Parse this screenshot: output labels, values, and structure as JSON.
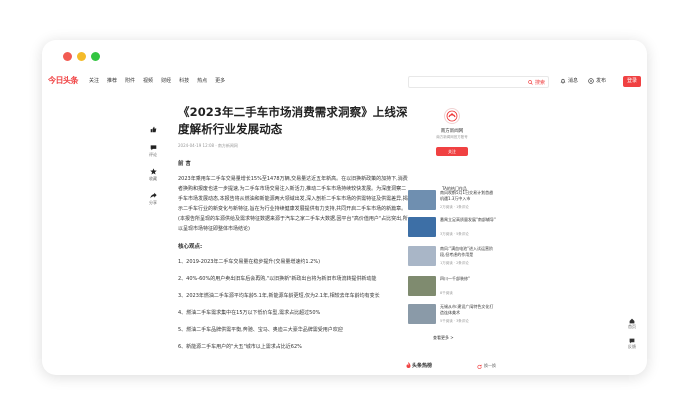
{
  "nav": {
    "logo": "今日头条",
    "links": [
      "关注",
      "推荐",
      "附件",
      "视频",
      "财经",
      "科技",
      "热点",
      "更多"
    ],
    "search_placeholder": "",
    "search_label": "搜索",
    "right": [
      "消息",
      "发布"
    ],
    "login": "登录"
  },
  "actions": [
    {
      "icon": "thumb-up-icon",
      "label": ""
    },
    {
      "icon": "comment-icon",
      "label": "评论"
    },
    {
      "icon": "star-icon",
      "label": "收藏"
    },
    {
      "icon": "share-icon",
      "label": "分享"
    }
  ],
  "article": {
    "title": "《2023年二手车市场消费需求洞察》上线深度解析行业发展动态",
    "meta": "2024-04-19 12:08 · 南方新闻网",
    "pre_heading": "前 言",
    "intro": "2023年乘用车二手车交易量增长15%至1478万辆,交易量达近五年新高。在以旧换新政策的加持下,消费者换购和报废也进一步提速,为二手车市场交易注入新活力,推动二手车市场持续较快发展。为深度洞察二手车市场发展动态,本报告将从燃油和新能源两大领域出发,深入剖析二手车市场的供需特征及供需差异,揭示二手车行业的新变化与新特征,旨在为行业持续健康发展提供有力支持,共同开启二手车市场的新篇章。(本报告所呈现的车源供给及需求特征数据来源于汽车之家二手车大数据,因平台\"高价值用户\"占比突出,所以呈现市场特征即整体市场结论)",
    "core_heading": "核心观点:",
    "points": [
      "1、2019-2023年二手车交易量在稳步提升(交易量增速约1.2%)",
      "2、40%-60%的用户卖出旧车后会再购,\"以旧换新\"新政出台将为新旧市场流转提供新动能",
      "3、2023年燃油二手车源平均车龄5.1年,新能源车龄更短,仅为2.1年,相较去年车龄均有变长",
      "4、燃油二手车需求集中在15万以下低价车型,需求占比超过50%",
      "5、燃油二手车品牌供需平衡,奔驰、宝马、奥迪三大豪华品牌需受用户欢迎",
      "6、新能源二手车用户的\"大五\"城市以上需求占比近62%"
    ]
  },
  "author": {
    "name": "南方新闻网",
    "desc": "南方新闻网官方账号",
    "follow": "关注"
  },
  "works_heading": "TA的热门作品",
  "works": [
    {
      "title": "南风吹鹤5月1日交易计划首趟机遇1.3万中入市",
      "stat": "2万阅读 · 1条评论",
      "color": "#6f8fb0"
    },
    {
      "title": "番禺立足高质量发展\"南部辅导\"",
      "stat": "3万阅读 · 5条评论",
      "color": "#3d6fa6"
    },
    {
      "title": "南风:\"满血电池\"进入试运营阶段,但考虑的作用是",
      "stat": "1万阅读 · 2条评论",
      "color": "#a9b6c7"
    },
    {
      "title": "四川一千部装修\"",
      "stat": "8千阅读",
      "color": "#7f8b6f"
    },
    {
      "title": "无锡从市:建设广阔特色文化打造连体美术",
      "stat": "5千阅读 · 3条评论",
      "color": "#8a9aa8"
    }
  ],
  "more_label": "查看更多 >",
  "hot": {
    "title": "头条热榜",
    "change": "换一换"
  },
  "float_buttons": [
    {
      "icon": "home-icon",
      "label": "首页"
    },
    {
      "icon": "feedback-icon",
      "label": "反馈"
    }
  ]
}
